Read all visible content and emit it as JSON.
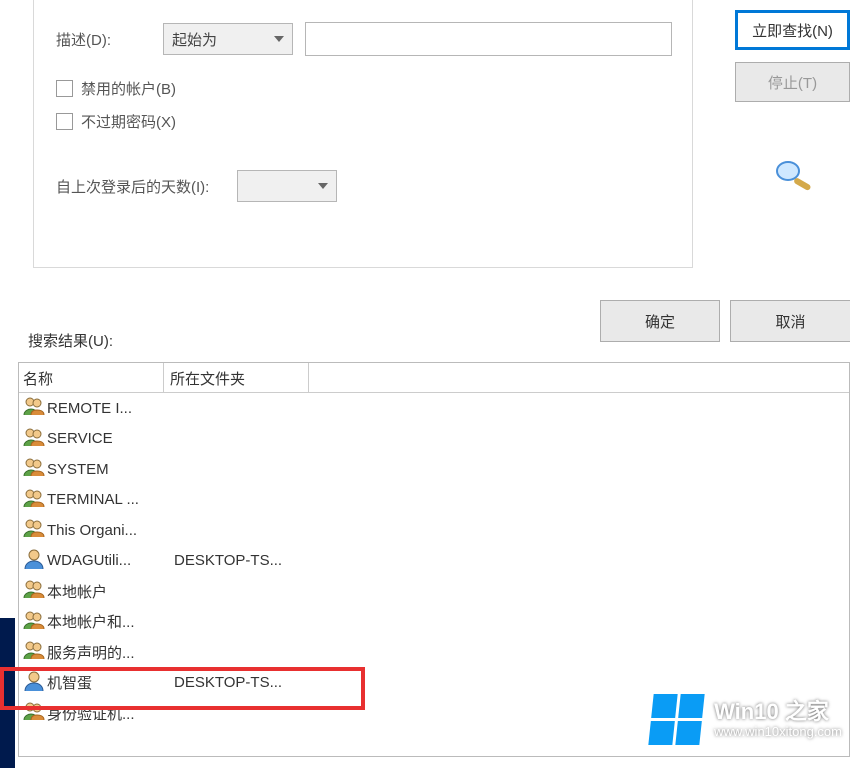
{
  "form": {
    "description_label": "描述(D):",
    "description_op": "起始为",
    "cb_disabled": "禁用的帐户(B)",
    "cb_nonexpiring": "不过期密码(X)",
    "days_label": "自上次登录后的天数(I):"
  },
  "buttons": {
    "find_now": "立即查找(N)",
    "stop": "停止(T)",
    "ok": "确定",
    "cancel": "取消"
  },
  "results_label": "搜索结果(U):",
  "columns": {
    "name": "名称",
    "folder": "所在文件夹"
  },
  "rows": [
    {
      "name": "REMOTE I...",
      "folder": "",
      "type": "group"
    },
    {
      "name": "SERVICE",
      "folder": "",
      "type": "group"
    },
    {
      "name": "SYSTEM",
      "folder": "",
      "type": "group"
    },
    {
      "name": "TERMINAL ...",
      "folder": "",
      "type": "group"
    },
    {
      "name": "This Organi...",
      "folder": "",
      "type": "group"
    },
    {
      "name": "WDAGUtili...",
      "folder": "DESKTOP-TS...",
      "type": "user"
    },
    {
      "name": "本地帐户",
      "folder": "",
      "type": "group"
    },
    {
      "name": "本地帐户和...",
      "folder": "",
      "type": "group"
    },
    {
      "name": "服务声明的...",
      "folder": "",
      "type": "group"
    },
    {
      "name": "机智蛋",
      "folder": "DESKTOP-TS...",
      "type": "user",
      "highlight": true
    },
    {
      "name": "身份验证机...",
      "folder": "",
      "type": "group"
    }
  ],
  "watermark": {
    "title": "Win10 之家",
    "url": "www.win10xitong.com"
  },
  "highlight_color": "#e83030",
  "icons": {
    "group": "group-icon",
    "user": "user-icon"
  }
}
